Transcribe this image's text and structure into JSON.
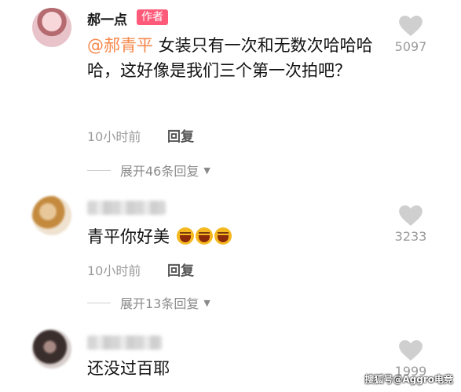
{
  "comments": [
    {
      "name": "郝一点",
      "badge": "作者",
      "mention": "@郝青平",
      "text": " 女装只有一次和无数次哈哈哈哈，这好像是我们三个第一次拍吧？",
      "time": "10小时前",
      "reply": "回复",
      "likes": "5097",
      "expand": "展开46条回复"
    },
    {
      "name": "",
      "text": "青平你好美",
      "time": "10小时前",
      "reply": "回复",
      "likes": "3233",
      "expand": "展开13条回复"
    },
    {
      "name": "",
      "text": "还没过百耶",
      "likes": "1999"
    }
  ],
  "icons": {
    "like": "heart-icon",
    "expand": "caret-down-icon",
    "emoji": "laughing-emoji-icon"
  },
  "colors": {
    "mention": "#f7874a",
    "badge": "#ff5a79",
    "heart": "#cfcfcf"
  },
  "watermark": "搜狐号@Aggro电竞"
}
